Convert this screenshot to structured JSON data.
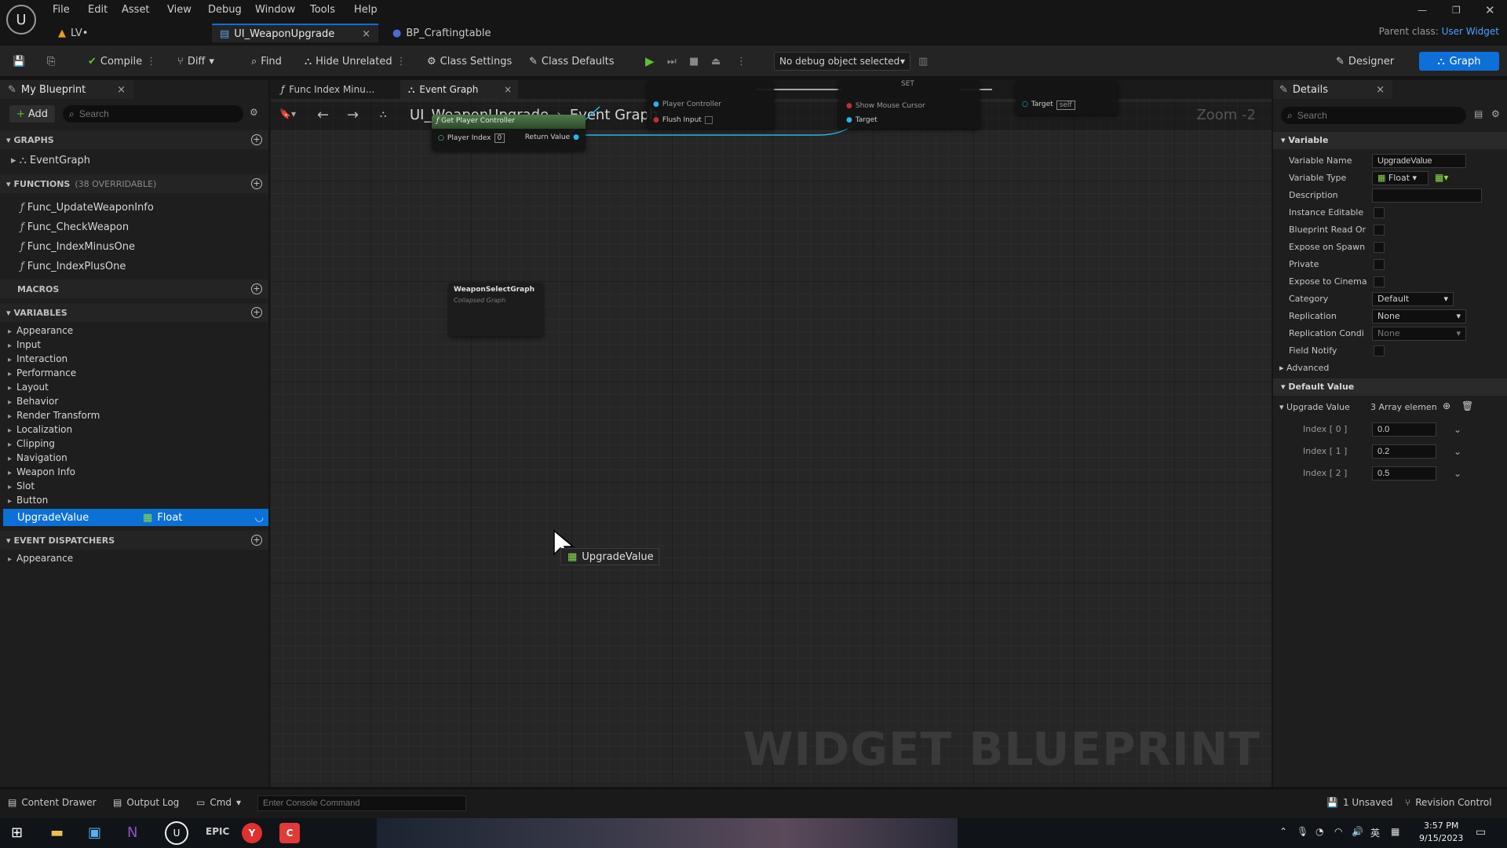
{
  "app": {
    "logo": "unreal-logo",
    "parent_class_label": "Parent class:",
    "parent_class_value": "User Widget"
  },
  "menu": [
    "File",
    "Edit",
    "Asset",
    "View",
    "Debug",
    "Window",
    "Tools",
    "Help"
  ],
  "doc_tabs": [
    {
      "label": "LV•",
      "active": false
    },
    {
      "label": "UI_WeaponUpgrade",
      "active": true
    },
    {
      "label": "BP_Craftingtable",
      "active": false
    }
  ],
  "toolbar": {
    "compile": "Compile",
    "diff": "Diff",
    "find": "Find",
    "hide_unrelated": "Hide Unrelated",
    "class_settings": "Class Settings",
    "class_defaults": "Class Defaults",
    "debug_object": "No debug object selected",
    "designer": "Designer",
    "graph": "Graph"
  },
  "my_blueprint": {
    "tab": "My Blueprint",
    "add": "Add",
    "search_placeholder": "Search",
    "graphs_header": "GRAPHS",
    "graphs": [
      "EventGraph"
    ],
    "functions_header": "FUNCTIONS",
    "functions_count": "(38 OVERRIDABLE)",
    "functions": [
      "Func_UpdateWeaponInfo",
      "Func_CheckWeapon",
      "Func_IndexMinusOne",
      "Func_IndexPlusOne"
    ],
    "macros_header": "MACROS",
    "variables_header": "VARIABLES",
    "variable_categories": [
      "Appearance",
      "Input",
      "Interaction",
      "Performance",
      "Layout",
      "Behavior",
      "Render Transform",
      "Localization",
      "Clipping",
      "Navigation",
      "Weapon Info",
      "Slot",
      "Button"
    ],
    "selected_variable": {
      "name": "UpgradeValue",
      "type": "Float"
    },
    "dispatchers_header": "EVENT DISPATCHERS",
    "dispatcher_categories": [
      "Appearance"
    ]
  },
  "graph": {
    "tabs": [
      "Func Index Minu...",
      "Event Graph"
    ],
    "breadcrumb_root": "UI_WeaponUpgrade",
    "breadcrumb_leaf": "Event Graph",
    "zoom": "Zoom -2",
    "watermark": "WIDGET BLUEPRINT",
    "drag_label": "UpgradeValue",
    "nodes": {
      "get_pc_title": "Get Player Controller",
      "get_pc_in": "Player Index",
      "get_pc_in_val": "0",
      "get_pc_out": "Return Value",
      "flush_pc": "Player Controller",
      "flush_input": "Flush Input",
      "set_title": "SET",
      "set_show": "Show Mouse Cursor",
      "set_target": "Target",
      "target_label": "Target",
      "target_val": "self",
      "collapsed_title": "WeaponSelectGraph",
      "collapsed_sub": "Collapsed Graph"
    }
  },
  "details": {
    "tab": "Details",
    "search_placeholder": "Search",
    "variable_section": "Variable",
    "rows": {
      "name_label": "Variable Name",
      "name_value": "UpgradeValue",
      "type_label": "Variable Type",
      "type_value": "Float",
      "description": "Description",
      "instance_editable": "Instance Editable",
      "blueprint_read": "Blueprint Read Or",
      "expose_spawn": "Expose on Spawn",
      "private": "Private",
      "expose_cinematics": "Expose to Cinema",
      "category_label": "Category",
      "category_value": "Default",
      "replication_label": "Replication",
      "replication_value": "None",
      "rep_condition_label": "Replication Condi",
      "rep_condition_value": "None",
      "field_notify": "Field Notify",
      "advanced": "Advanced"
    },
    "default_section": "Default Value",
    "array_label": "Upgrade Value",
    "array_count": "3 Array elemen",
    "array": [
      {
        "label": "Index [ 0 ]",
        "value": "0.0"
      },
      {
        "label": "Index [ 1 ]",
        "value": "0.2"
      },
      {
        "label": "Index [ 2 ]",
        "value": "0.5"
      }
    ]
  },
  "status": {
    "content_drawer": "Content Drawer",
    "output_log": "Output Log",
    "cmd": "Cmd",
    "console_placeholder": "Enter Console Command",
    "unsaved": "1 Unsaved",
    "revision": "Revision Control"
  },
  "taskbar": {
    "time": "3:57 PM",
    "date": "9/15/2023",
    "lang": "英"
  },
  "colors": {
    "accent": "#0e6fd8",
    "float_green": "#8cd94a",
    "selected_row": "#0c70d6"
  }
}
